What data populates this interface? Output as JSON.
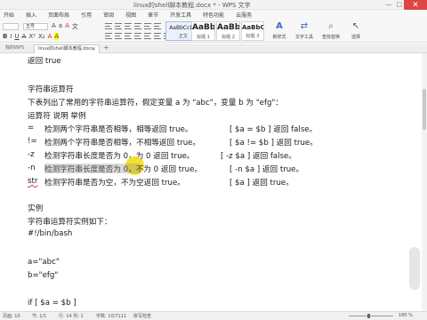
{
  "window": {
    "title": "linux的shell脚本教程.docx * - WPS 文字",
    "min": "—",
    "max": "□",
    "close": "✕"
  },
  "menu_tabs": [
    "开始",
    "插入",
    "页面布局",
    "引用",
    "审阅",
    "视图",
    "章节",
    "开发工具",
    "特色功能",
    "云服务"
  ],
  "ribbon": {
    "font_name": "",
    "font_size": "五号",
    "styles": [
      {
        "sample": "AaBbCcDd",
        "name": "正文"
      },
      {
        "sample": "AaBb",
        "name": "标题 1"
      },
      {
        "sample": "AaBb",
        "name": "标题 2"
      },
      {
        "sample": "AaBbC",
        "name": "标题 3"
      }
    ],
    "tools": [
      {
        "icon": "A",
        "label": "新样式"
      },
      {
        "icon": "⇄",
        "label": "文字工具"
      },
      {
        "icon": "⌕",
        "label": "查找替换"
      },
      {
        "icon": "↖",
        "label": "选择"
      }
    ]
  },
  "doc_tabs": {
    "first": "我的WPS",
    "active": "linux的shell脚本教程.docx",
    "close": "×",
    "add": "+"
  },
  "document": {
    "line_return_true": "返回  true",
    "heading_string_ops": "字符串运算符",
    "intro": "下表列出了常用的字符串运算符，假定变量  a  为  \"abc\"，变量  b  为  \"efg\"：",
    "table_header": "运算符    说明        举例",
    "rows": [
      {
        "op": "=",
        "desc": "检测两个字符串是否相等，相等返回  true。",
        "example": "[ $a = $b ]  返回  false。"
      },
      {
        "op": "!=",
        "desc": "检测两个字符串是否相等，不相等返回  true。",
        "example": "[ $a != $b ]  返回  true。"
      },
      {
        "op": "-z",
        "desc": "检测字符串长度是否为 0，为 0 返回  true。",
        "example": "[ -z $a ]  返回  false。"
      },
      {
        "op": "-n",
        "desc": "检测字符串长度是否为 0，不为 0 返回  true。",
        "example": "[ -n $a ]  返回  true。"
      },
      {
        "op": "str",
        "desc": "检测字符串是否为空，不为空返回  true。",
        "example": "[ $a ]  返回  true。"
      }
    ],
    "example_heading": "实例",
    "example_intro": "字符串运算符实例如下：",
    "shebang": "#!/bin/bash",
    "assign_a": "a=\"abc\"",
    "assign_b": "b=\"efg\"",
    "if_line": "if [ $a = $b ]"
  },
  "status": {
    "page": "页面: 10",
    "section": "节: 1/1",
    "row_col": "行: 14  列: 1",
    "words": "字数: 10/7111",
    "spell": "拼写检查",
    "zoom": "180 %"
  }
}
